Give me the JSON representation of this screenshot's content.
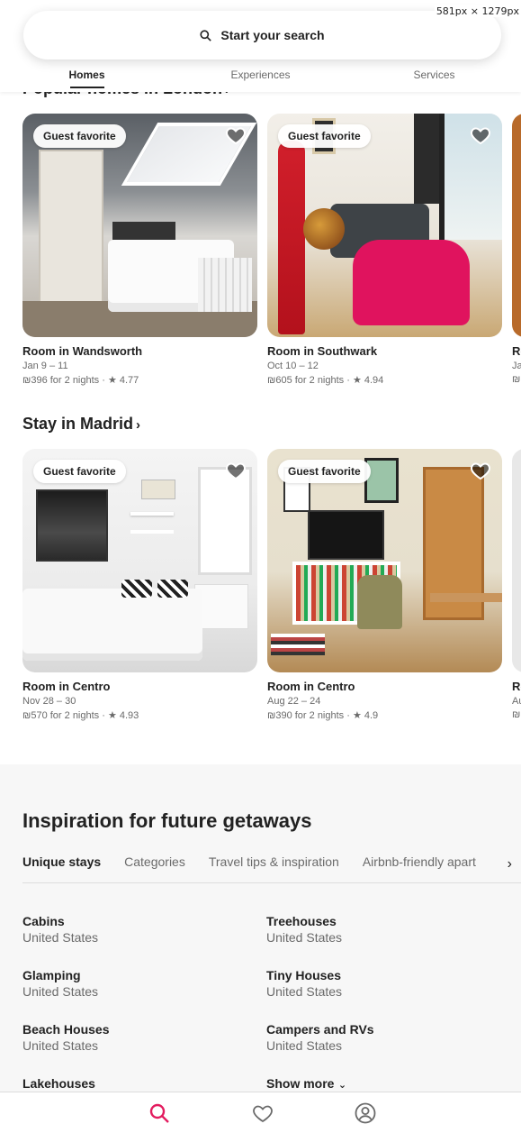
{
  "window_overlay": "581px × 1279px",
  "search": {
    "label": "Start your search"
  },
  "tabs": [
    {
      "label": "Homes",
      "active": true
    },
    {
      "label": "Experiences",
      "active": false
    },
    {
      "label": "Services",
      "active": false
    }
  ],
  "sections": [
    {
      "title": "Popular homes in London",
      "cards": [
        {
          "badge": "Guest favorite",
          "title": "Room in Wandsworth",
          "dates": "Jan 9 – 11",
          "price": "₪396 for 2 nights · ★ 4.77"
        },
        {
          "badge": "Guest favorite",
          "title": "Room in Southwark",
          "dates": "Oct 10 – 12",
          "price": "₪605 for 2 nights · ★ 4.94"
        }
      ],
      "peek": {
        "title": "Ro",
        "dates": "Ja",
        "price": "₪"
      }
    },
    {
      "title": "Stay in Madrid",
      "cards": [
        {
          "badge": "Guest favorite",
          "title": "Room in Centro",
          "dates": "Nov 28 – 30",
          "price": "₪570 for 2 nights · ★ 4.93"
        },
        {
          "badge": "Guest favorite",
          "title": "Room in Centro",
          "dates": "Aug 22 – 24",
          "price": "₪390 for 2 nights · ★ 4.9"
        }
      ],
      "peek": {
        "title": "Ro",
        "dates": "Au",
        "price": "₪"
      }
    }
  ],
  "inspiration": {
    "title": "Inspiration for future getaways",
    "tabs": [
      {
        "label": "Unique stays",
        "active": true
      },
      {
        "label": "Categories",
        "active": false
      },
      {
        "label": "Travel tips & inspiration",
        "active": false
      },
      {
        "label": "Airbnb-friendly apart",
        "active": false
      }
    ],
    "items": [
      {
        "name": "Cabins",
        "location": "United States"
      },
      {
        "name": "Treehouses",
        "location": "United States"
      },
      {
        "name": "Glamping",
        "location": "United States"
      },
      {
        "name": "Tiny Houses",
        "location": "United States"
      },
      {
        "name": "Beach Houses",
        "location": "United States"
      },
      {
        "name": "Campers and RVs",
        "location": "United States"
      },
      {
        "name": "Lakehouses",
        "location": ""
      }
    ],
    "show_more": "Show more"
  },
  "bottom_nav": [
    {
      "icon": "search-icon",
      "active": true
    },
    {
      "icon": "heart-icon",
      "active": false
    },
    {
      "icon": "profile-icon",
      "active": false
    }
  ],
  "colors": {
    "accent": "#e31c5f",
    "text": "#222222",
    "muted": "#6a6a6a"
  }
}
